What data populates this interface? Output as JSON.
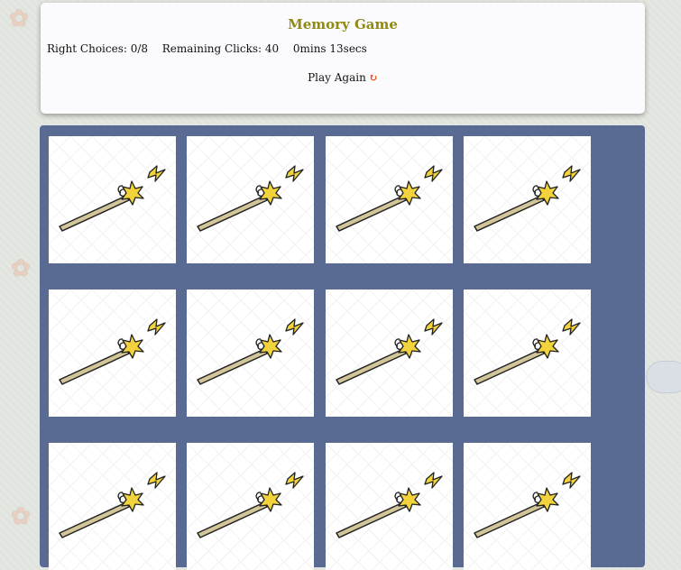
{
  "header": {
    "title": "Memory Game",
    "right_choices_label": "Right Choices:",
    "right_choices_value": "0/8",
    "remaining_clicks_label": "Remaining Clicks:",
    "remaining_clicks_value": "40",
    "timer": "0mins 13secs",
    "play_again_label": "Play Again",
    "refresh_icon": "↻"
  },
  "board": {
    "cards": [
      {
        "face": "wand-icon"
      },
      {
        "face": "wand-icon"
      },
      {
        "face": "wand-icon"
      },
      {
        "face": "wand-icon"
      },
      {
        "face": "wand-icon"
      },
      {
        "face": "wand-icon"
      },
      {
        "face": "wand-icon"
      },
      {
        "face": "wand-icon"
      },
      {
        "face": "wand-icon"
      },
      {
        "face": "wand-icon"
      },
      {
        "face": "wand-icon"
      },
      {
        "face": "wand-icon"
      }
    ]
  },
  "colors": {
    "title": "#8f8a14",
    "board_bg": "#596a93",
    "refresh": "#e8541c"
  }
}
